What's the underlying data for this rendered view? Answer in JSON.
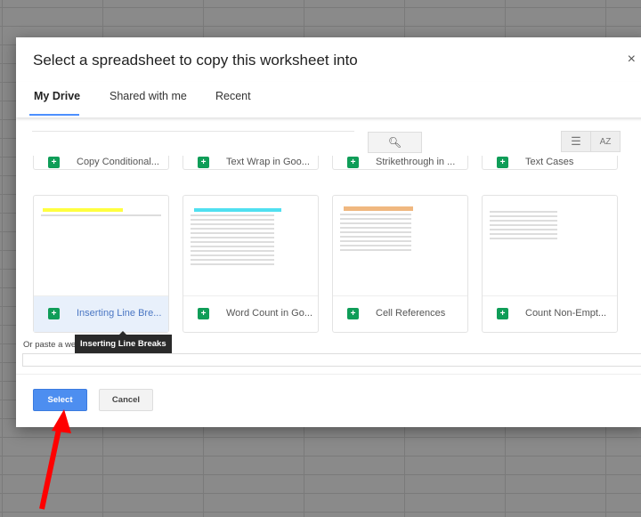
{
  "dialog": {
    "title": "Select a spreadsheet to copy this worksheet into",
    "close_icon": "×"
  },
  "tabs": [
    {
      "label": "My Drive",
      "active": true
    },
    {
      "label": "Shared with me"
    },
    {
      "label": "Recent"
    }
  ],
  "toolbar": {
    "search_icon": "search-icon",
    "list_view_icon": "list-icon",
    "sort_label": "AZ"
  },
  "files_top_row": [
    "Copy Conditional...",
    "Text Wrap in Goo...",
    "Strikethrough in ...",
    "Text Cases"
  ],
  "files": [
    {
      "name": "Inserting Line Bre...",
      "selected": true
    },
    {
      "name": "Word Count in Go..."
    },
    {
      "name": "Cell References"
    },
    {
      "name": "Count Non-Empt..."
    }
  ],
  "tooltip": "Inserting Line Breaks",
  "paste_label": "Or paste a we",
  "buttons": {
    "select": "Select",
    "cancel": "Cancel"
  },
  "colors": {
    "accent": "#4d8ef0",
    "sheets_green": "#0f9d58",
    "arrow": "#ff0000"
  }
}
